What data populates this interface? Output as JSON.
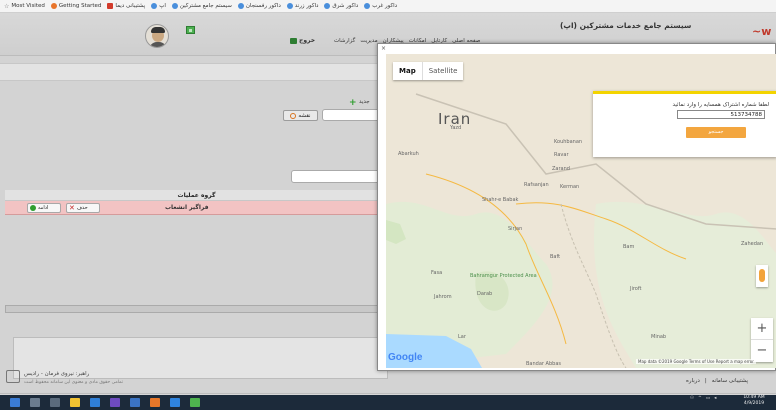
{
  "bookmarks": [
    {
      "label": "Most Visited",
      "icon": "star-icon"
    },
    {
      "label": "Getting Started",
      "icon": "firefox-icon"
    },
    {
      "label": "پشتیبانی دیما",
      "icon": "bookmark-icon"
    },
    {
      "label": "اپ",
      "icon": "globe-icon"
    },
    {
      "label": "سیستم جامع مشترکین",
      "icon": "globe-icon"
    },
    {
      "label": "داکور رفسنجان",
      "icon": "globe-icon"
    },
    {
      "label": "داکور زرند",
      "icon": "globe-icon"
    },
    {
      "label": "داکور شرق",
      "icon": "globe-icon"
    },
    {
      "label": "داکور غرب",
      "icon": "globe-icon"
    }
  ],
  "header": {
    "title": "سیستم جامع خدمات مشترکین (اپ)",
    "logout_label": "خروج",
    "menu": [
      "صفحه اصلی",
      "کارتابل",
      "امکانات",
      "پیشکاران",
      "مدیریت",
      "گزارشات"
    ]
  },
  "content": {
    "add_label": "جدید",
    "search_label": "نقشه",
    "table_header": "گروه عملیات",
    "row_value": "فراگیر انشعاب",
    "edit_label": "ادامه",
    "delete_label": "حذف",
    "footer_org": "راهبر: نیروی فرمان - رادیس",
    "footer_note": "تمامی حقوق مادی و معنوی این سامانه محفوظ است",
    "footer_links": [
      "درباره",
      "پشتیبانی سامانه"
    ]
  },
  "modal": {
    "close": "×",
    "map_tab": "Map",
    "satellite_tab": "Satellite",
    "country": "Iran",
    "places": [
      {
        "name": "Yazd"
      },
      {
        "name": "Abarkuh"
      },
      {
        "name": "Kouhbanan"
      },
      {
        "name": "Ravar"
      },
      {
        "name": "Zarand"
      },
      {
        "name": "Rafsanjan"
      },
      {
        "name": "Kerman"
      },
      {
        "name": "Shahr-e Babak"
      },
      {
        "name": "Sirjan"
      },
      {
        "name": "Bam"
      },
      {
        "name": "Baft"
      },
      {
        "name": "Fasa"
      },
      {
        "name": "Bahramgur Protected Area"
      },
      {
        "name": "Darab"
      },
      {
        "name": "Jahrom"
      },
      {
        "name": "Jiroft"
      },
      {
        "name": "Zahedan"
      },
      {
        "name": "Lar"
      },
      {
        "name": "Minab"
      },
      {
        "name": "Bandar Abbas"
      }
    ],
    "popup_message": "لطفا شماره اشتراک همسایه را وارد نمائید",
    "popup_value": "513734788",
    "popup_button": "جستجو",
    "zoom_in": "+",
    "zoom_out": "−",
    "google": "Google",
    "attribution": "Map data ©2019 Google   Terms of Use   Report a map error"
  },
  "taskbar": {
    "time": "10:49 AM",
    "date": "4/9/2019"
  }
}
